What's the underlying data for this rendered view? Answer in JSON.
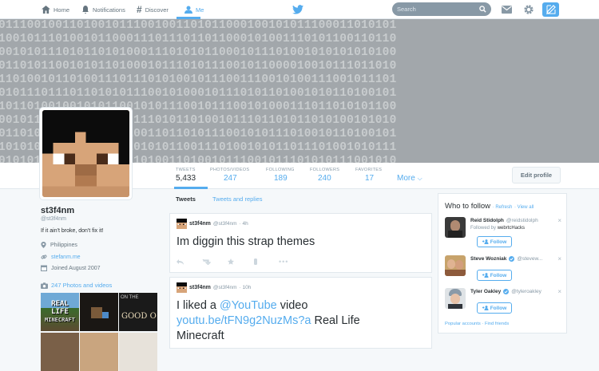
{
  "nav": {
    "home": "Home",
    "notifications": "Notifications",
    "discover": "Discover",
    "me": "Me",
    "search_placeholder": "Search"
  },
  "header": {
    "binary_rows": [
      "01110010011010010111001001101011000100101011100011010101",
      "10010111010010110001110111011011000101001110101100110110",
      "00101011101011010100011101010110001011101001010101010100",
      "01101011001010110100010111010111001011000010010111011010",
      "11010010110100111011101010010111001110010100111001011101",
      "01011101110110101011100101000101110101101001010110100101",
      "10110100100101011001010111001011100101000111011010101100",
      "00101110010111011001110101101001011101101011010100101010",
      "01101011101000101110011011010111001010111010010110100101",
      "10101001011101110010101011001110100101011011101001010111",
      "01010111010011010111010011010010111001011101010111001010"
    ]
  },
  "stats": [
    {
      "label": "TWEETS",
      "value": "5,433"
    },
    {
      "label": "PHOTOS/VIDEOS",
      "value": "247"
    },
    {
      "label": "FOLLOWING",
      "value": "189"
    },
    {
      "label": "FOLLOWERS",
      "value": "240"
    },
    {
      "label": "FAVORITES",
      "value": "17"
    }
  ],
  "more_label": "More",
  "edit_profile": "Edit profile",
  "profile": {
    "name": "st3f4nm",
    "handle": "@st3f4nm",
    "bio": "If it ain't broke, don't fix it!",
    "location": "Philippines",
    "website": "stefanm.me",
    "joined": "Joined August 2007",
    "photos_link": "247 Photos and videos"
  },
  "thumbs": {
    "t1": "REAL LIFE",
    "t1b": "MINECRAFT",
    "t3a": "ON THE",
    "t3b": "GOOD O"
  },
  "timeline_tabs": {
    "tweets": "Tweets",
    "replies": "Tweets and replies"
  },
  "tweets": [
    {
      "name": "st3f4nm",
      "handle": "@st3f4nm",
      "time": "· 4h",
      "text": "Im diggin this strap themes"
    },
    {
      "name": "st3f4nm",
      "handle": "@st3f4nm",
      "time": "· 10h",
      "text_pre": "I liked a ",
      "mention": "@YouTube",
      "text_mid": " video",
      "link": "youtu.be/tFN9g2NuzMs?a",
      "text_post": " Real Life",
      "text_line3": "Minecraft"
    }
  ],
  "who_to_follow": {
    "title": "Who to follow",
    "refresh": "Refresh",
    "view_all": "View all",
    "follow_label": "Follow",
    "users": [
      {
        "name": "Reid Stidolph",
        "handle": "@reidstidolph",
        "followed_by": "Followed by ",
        "followed_by_user": "webrtcHacks",
        "verified": false
      },
      {
        "name": "Steve Wozniak",
        "handle": "@stevew...",
        "verified": true
      },
      {
        "name": "Tyler Oakley",
        "handle": "@tyleroakley",
        "verified": true
      }
    ],
    "footer": "Popular accounts · Find friends"
  },
  "colors": {
    "accent": "#55acee",
    "header_bg": "#a2a7ab"
  }
}
